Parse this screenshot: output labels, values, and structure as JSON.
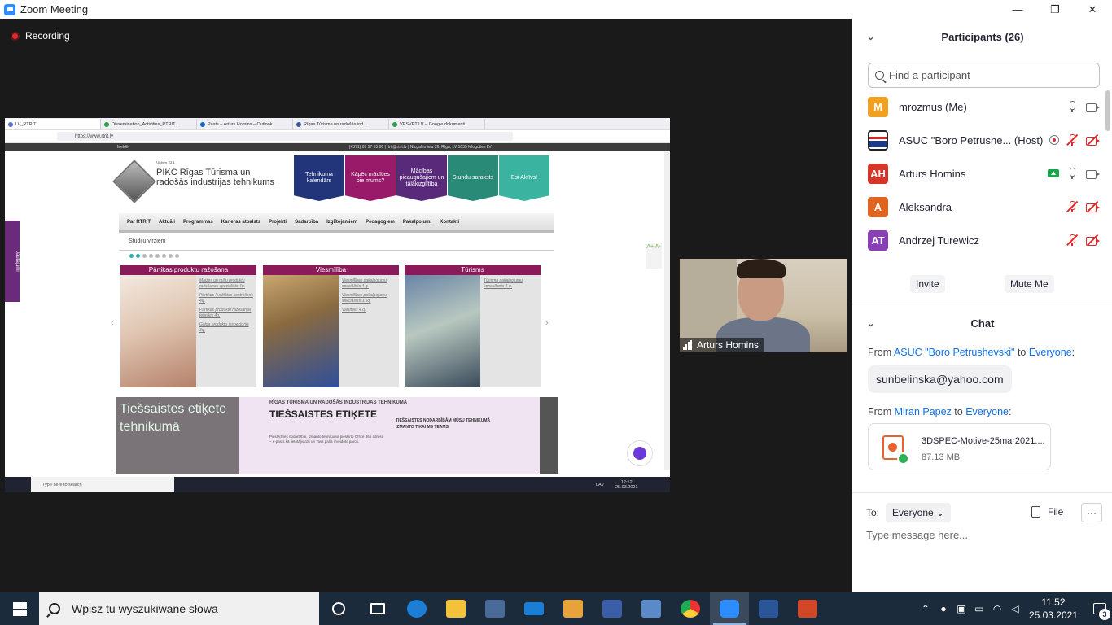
{
  "window": {
    "title": "Zoom Meeting",
    "minimize": "—",
    "maximize": "❐",
    "close": "✕"
  },
  "meeting": {
    "recording_label": "Recording",
    "video_participant_name": "Arturs Homins"
  },
  "shared_screen": {
    "tabs": [
      "LV_RTRIT",
      "Dissemination_Activities_RTRIT...",
      "Pasts – Arturs Homins – Outlook",
      "Rīgas Tūrisma un radošās ind...",
      "VESVET LV – Google dokumenti"
    ],
    "url": "https://www.rtrit.lv",
    "site_topbar_search": "Meklēt",
    "site_topbar_contact": "(+371) 67 57 55 80  |  rtrit@rtrit.lv  |  Nīcgales iela 26, Rīga, LV 1035   Ielogoties  LV",
    "logo_small": "Valsts SIA",
    "logo_text": "PIKC Rīgas Tūrisma un radošās industrijas tehnikums",
    "tiles": [
      "Tehnikuma kalendārs",
      "Kāpēc mācīties pie mums?",
      "Mācības pieaugušajiem un tālākizglītība",
      "Stundu saraksts",
      "Esi Aktīvs!"
    ],
    "menu": [
      "Par RTRIT",
      "Aktuāli",
      "Programmas",
      "Karjeras atbalsts",
      "Projekti",
      "Sadarbība",
      "Izglītojamiem",
      "Pedagogiem",
      "Pakalpojumi",
      "Kontakti"
    ],
    "studiju": "Studiju virzieni",
    "cards": [
      {
        "title": "Pārtikas produktu ražošana",
        "links": [
          "Maizes un miltu produktu ražošanas speciālists 4q.",
          "Pārtikas kvalitātes kontrolieris 4q.",
          "Pārtikas produktu ražošanas tehniķis 4q.",
          "Galda produktu inspektorijs 3q."
        ]
      },
      {
        "title": "Viesmīlība",
        "links": [
          "Viesmīlības pakalpojumu speciālists 4 q.",
          "Viesmīlības pakalpojumu speciālists 3.5q.",
          "Viesmīlis 4 q."
        ]
      },
      {
        "title": "Tūrisms",
        "links": [
          "Tūrisma pakalpojumu konsultants 4 q."
        ]
      }
    ],
    "banner_left": "Tiešsaistes etiķete tehnikumā",
    "banner_t1": "RĪGAS TŪRISMA UN RADOŠĀS INDUSTRIJAS TEHNIKUMA",
    "banner_t2": "TIEŠSAISTES ETIĶETE",
    "banner_t3": "Pieslēdzies nodarbībai, izmanto tehnikuma piešķirto Office 365 adresi – e-pasts kā lietotājvārds un Tavs paša izveidoto paroli.",
    "banner_t4": "TIEŠSAISTES NODARBĪBĀM MŪSU TEHNIKUMĀ IZMANTO TIKAI MS TEAMS",
    "side_tab": "Jautājumi",
    "aplus": "A+ A-",
    "os_search": "Type here to search",
    "os_lang": "LAV",
    "os_time": "12:52",
    "os_date": "25.03.2021"
  },
  "panel": {
    "participants_title": "Participants (26)",
    "find_placeholder": "Find a participant",
    "participants": [
      {
        "initials": "M",
        "name": "mrozmus (Me)",
        "color": "#f0a023"
      },
      {
        "initials": "",
        "name": "ASUC \"Boro Petrushe... (Host)",
        "color": "#1a1a1a"
      },
      {
        "initials": "AH",
        "name": "Arturs Homins",
        "color": "#d8352a"
      },
      {
        "initials": "A",
        "name": "Aleksandra",
        "color": "#e0631f"
      },
      {
        "initials": "AT",
        "name": "Andrzej Turewicz",
        "color": "#8a3fb6"
      }
    ],
    "invite_label": "Invite",
    "mute_me_label": "Mute Me",
    "chat_title": "Chat",
    "messages": [
      {
        "from_prefix": "From ",
        "sender": "ASUC \"Boro Petrushevski\"",
        "to_word": " to ",
        "recipient": "Everyone",
        "suffix": ":",
        "text": "sunbelinska@yahoo.com"
      },
      {
        "from_prefix": "From ",
        "sender": "Miran Papez",
        "to_word": " to ",
        "recipient": "Everyone",
        "suffix": ":",
        "file_name": "3DSPEC-Motive-25mar2021....",
        "file_size": "87.13 MB"
      }
    ],
    "to_label": "To:",
    "to_value": "Everyone ⌄",
    "file_label": "File",
    "more_label": "···",
    "type_placeholder": "Type message here..."
  },
  "taskbar": {
    "search_text": "Wpisz tu wyszukiwane słowa",
    "time": "11:52",
    "date": "25.03.2021",
    "notifications": "3"
  }
}
